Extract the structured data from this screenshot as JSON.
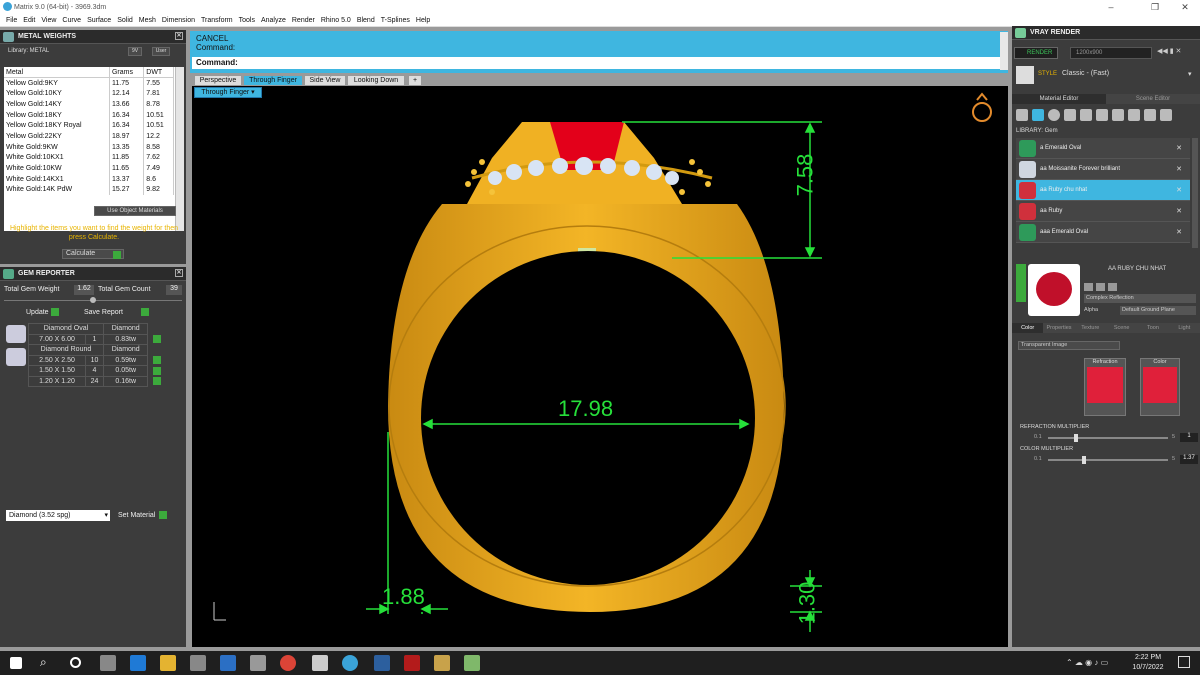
{
  "window": {
    "title": "Matrix 9.0 (64-bit) - 3969.3dm"
  },
  "menu": [
    "File",
    "Edit",
    "View",
    "Curve",
    "Surface",
    "Solid",
    "Mesh",
    "Dimension",
    "Transform",
    "Tools",
    "Analyze",
    "Render",
    "Rhino 5.0",
    "Blend",
    "T-Splines",
    "Help"
  ],
  "metal_weights": {
    "title": "METAL WEIGHTS",
    "library_label": "Library: METAL",
    "columns": [
      "Metal",
      "Grams",
      "DWT"
    ],
    "rows": [
      [
        "Yellow Gold:9KY",
        "11.75",
        "7.55"
      ],
      [
        "Yellow Gold:10KY",
        "12.14",
        "7.81"
      ],
      [
        "Yellow Gold:14KY",
        "13.66",
        "8.78"
      ],
      [
        "Yellow Gold:18KY",
        "16.34",
        "10.51"
      ],
      [
        "Yellow Gold:18KY Royal",
        "16.34",
        "10.51"
      ],
      [
        "Yellow Gold:22KY",
        "18.97",
        "12.2"
      ],
      [
        "White Gold:9KW",
        "13.35",
        "8.58"
      ],
      [
        "White Gold:10KX1",
        "11.85",
        "7.62"
      ],
      [
        "White Gold:10KW",
        "11.65",
        "7.49"
      ],
      [
        "White Gold:14KX1",
        "13.37",
        "8.6"
      ],
      [
        "White Gold:14K PdW",
        "15.27",
        "9.82"
      ]
    ],
    "use_object_materials": "Use Object Materials",
    "hint": "Highlight the items you want to find the weight for then press Calculate.",
    "calculate": "Calculate"
  },
  "gem_reporter": {
    "title": "GEM REPORTER",
    "total_weight_label": "Total Gem Weight",
    "total_weight": "1.62",
    "total_count_label": "Total Gem Count",
    "total_count": "39",
    "update": "Update",
    "save_report": "Save Report",
    "groups": [
      {
        "name": "Diamond Oval",
        "type": "Diamond",
        "rows": [
          [
            "7.00 X 6.00",
            "1",
            "0.83tw"
          ]
        ]
      },
      {
        "name": "Diamond Round",
        "type": "Diamond",
        "rows": [
          [
            "2.50 X 2.50",
            "10",
            "0.59tw"
          ],
          [
            "1.50 X 1.50",
            "4",
            "0.05tw"
          ],
          [
            "1.20 X 1.20",
            "24",
            "0.16tw"
          ]
        ]
      }
    ],
    "material_select": "Diamond      (3.52 spg)",
    "set_material": "Set Material"
  },
  "command": {
    "line1": "CANCEL",
    "line2": "Command:",
    "prompt": "Command:"
  },
  "view_tabs": [
    "Perspective",
    "Through Finger",
    "Side View",
    "Looking Down"
  ],
  "active_view": "Through Finger",
  "dimensions": {
    "top_height": "7.58",
    "inner_diameter": "17.98",
    "band_width": "1.88",
    "band_thickness": "1.30"
  },
  "vray": {
    "title": "VRAY RENDER",
    "render": "RENDER",
    "resolution": "1200x900",
    "style_label": "STYLE",
    "style_value": "Classic - (Fast)",
    "tabs": [
      "Material Editor",
      "Scene Editor"
    ],
    "library_label": "LIBRARY: Gem",
    "items": [
      {
        "name": "a Emerald Oval",
        "color": "#2e9a5a"
      },
      {
        "name": "aa Moissanite Forever brilliant",
        "color": "#cfd6e0"
      },
      {
        "name": "aa Ruby chu nhat",
        "color": "#d0303c"
      },
      {
        "name": "aa Ruby",
        "color": "#d0303c"
      },
      {
        "name": "aaa Emerald Oval",
        "color": "#2e9a5a"
      }
    ],
    "selected_item": "aa Ruby chu nhat",
    "preview_title": "AA RUBY CHU NHAT",
    "reflection": "Complex Reflection",
    "alpha": "Alpha",
    "ground": "Default Ground Plane",
    "subtabs": [
      "Color",
      "Properties",
      "Texture",
      "Scene",
      "Toon",
      "Light"
    ],
    "image_mode": "Transparent Image",
    "refraction_label": "Refraction",
    "color_label": "Color",
    "refraction_multiplier_label": "REFRACTION MULTIPLIER",
    "refraction_min": "0.1",
    "refraction_max": "5",
    "refraction_value": "1",
    "color_multiplier_label": "COLOR MULTIPLIER",
    "color_min": "0.1",
    "color_max": "5",
    "color_value": "1.37"
  },
  "taskbar": {
    "time": "2:22 PM",
    "date": "10/7/2022"
  }
}
